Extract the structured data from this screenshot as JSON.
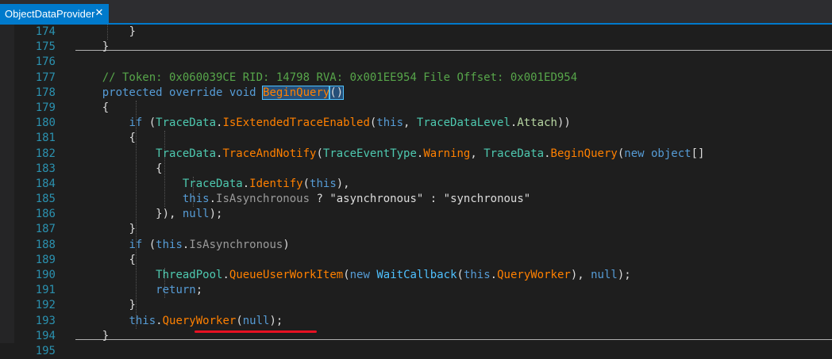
{
  "tab": {
    "title": "ObjectDataProvider",
    "close_glyph": "✕"
  },
  "line_numbers": [
    "174",
    "175",
    "176",
    "177",
    "178",
    "179",
    "180",
    "181",
    "182",
    "183",
    "184",
    "185",
    "186",
    "187",
    "188",
    "189",
    "190",
    "191",
    "192",
    "193",
    "194",
    "195"
  ],
  "code": {
    "l174": "}",
    "l175": "}",
    "l177": "// Token: 0x060039CE RID: 14798 RVA: 0x001EE954 File Offset: 0x001ED954",
    "l178_kw": "protected override void",
    "l178_name": "BeginQuery",
    "l178_parens": "()",
    "l179": "{",
    "l180_if": "if",
    "l180_open": " (",
    "l180_type": "TraceData",
    "l180_dot": ".",
    "l180_method": "IsExtendedTraceEnabled",
    "l180_p1": "(",
    "l180_this": "this",
    "l180_comma": ", ",
    "l180_type2": "TraceDataLevel",
    "l180_dot2": ".",
    "l180_enum": "Attach",
    "l180_close": "))",
    "l181": "{",
    "l182_type": "TraceData",
    "l182_dot": ".",
    "l182_method": "TraceAndNotify",
    "l182_p": "(",
    "l182_type2": "TraceEventType",
    "l182_dot2": ".",
    "l182_enum": "Warning",
    "l182_comma": ", ",
    "l182_type3": "TraceData",
    "l182_dot3": ".",
    "l182_method2": "BeginQuery",
    "l182_p2": "(",
    "l182_new": "new object",
    "l182_br": "[]",
    "l183": "{",
    "l184_type": "TraceData",
    "l184_dot": ".",
    "l184_method": "Identify",
    "l184_p": "(",
    "l184_this": "this",
    "l184_end": "),",
    "l185_this": "this",
    "l185_dot": ".",
    "l185_prop": "IsAsynchronous",
    "l185_q": " ? ",
    "l185_s1": "\"asynchronous\"",
    "l185_colon": " : ",
    "l185_s2": "\"synchronous\"",
    "l186_a": "}), ",
    "l186_null": "null",
    "l186_b": ");",
    "l187": "}",
    "l188_if": "if",
    "l188_open": " (",
    "l188_this": "this",
    "l188_dot": ".",
    "l188_prop": "IsAsynchronous",
    "l188_close": ")",
    "l189": "{",
    "l190_type": "ThreadPool",
    "l190_dot": ".",
    "l190_method": "QueueUserWorkItem",
    "l190_p": "(",
    "l190_new": "new",
    "l190_sp": " ",
    "l190_type2": "WaitCallback",
    "l190_p2": "(",
    "l190_this": "this",
    "l190_dot2": ".",
    "l190_method2": "QueryWorker",
    "l190_c": "), ",
    "l190_null": "null",
    "l190_end": ");",
    "l191": "return",
    "l191_semi": ";",
    "l192": "}",
    "l193_this": "this",
    "l193_dot": ".",
    "l193_method": "QueryWorker",
    "l193_p": "(",
    "l193_null": "null",
    "l193_end": ");",
    "l194": "}"
  },
  "colors": {
    "line_number": "#2b91af",
    "keyword": "#569cd6",
    "type": "#4ec9b0",
    "method": "#ff8000",
    "comment": "#57a64a",
    "string": "#d69d85",
    "underline": "#e81123"
  }
}
